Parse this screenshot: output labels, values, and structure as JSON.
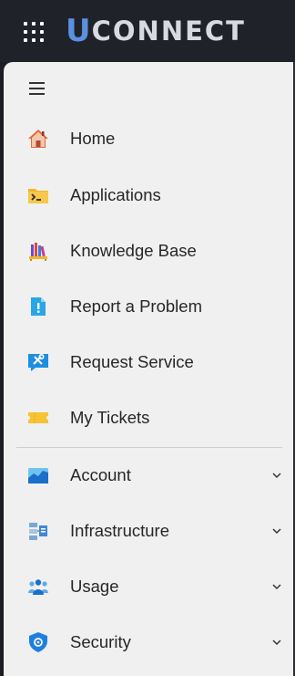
{
  "header": {
    "brand_u": "U",
    "brand_rest": "CONNECT",
    "menu_icon": "app-launcher-icon"
  },
  "sidebar": {
    "toggle_icon": "hamburger-menu-icon",
    "items": [
      {
        "label": "Home",
        "icon": "home-icon"
      },
      {
        "label": "Applications",
        "icon": "terminal-folder-icon"
      },
      {
        "label": "Knowledge Base",
        "icon": "books-icon"
      },
      {
        "label": "Report a Problem",
        "icon": "report-document-icon"
      },
      {
        "label": "Request Service",
        "icon": "service-tools-icon"
      },
      {
        "label": "My Tickets",
        "icon": "ticket-icon"
      }
    ],
    "sections": [
      {
        "label": "Account",
        "icon": "account-chart-icon",
        "expandable": true
      },
      {
        "label": "Infrastructure",
        "icon": "infrastructure-icon",
        "expandable": true
      },
      {
        "label": "Usage",
        "icon": "users-group-icon",
        "expandable": true
      },
      {
        "label": "Security",
        "icon": "shield-icon",
        "expandable": true
      }
    ]
  },
  "colors": {
    "topbar": "#1f2329",
    "sidebar_bg": "#f0f0f0",
    "brand_u": "#5b8fe0",
    "brand_text": "#d7dbe1",
    "label": "#262626"
  }
}
